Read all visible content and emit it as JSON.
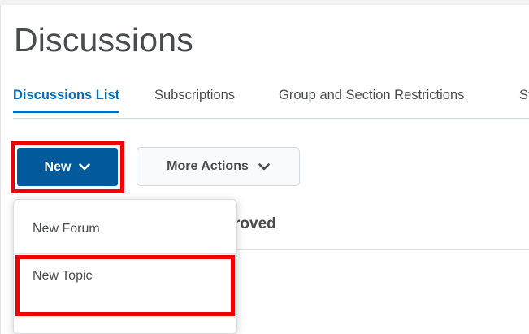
{
  "page": {
    "title": "Discussions"
  },
  "tabs": [
    {
      "label": "Discussions List",
      "active": true
    },
    {
      "label": "Subscriptions",
      "active": false
    },
    {
      "label": "Group and Section Restrictions",
      "active": false
    },
    {
      "label": "St",
      "active": false
    }
  ],
  "toolbar": {
    "new_label": "New",
    "more_actions_label": "More Actions",
    "chevron_icon": "chevron-down-icon"
  },
  "content": {
    "partial_heading": "roved"
  },
  "dropdown": {
    "items": [
      {
        "label": "New Forum"
      },
      {
        "label": "New Topic"
      }
    ]
  },
  "colors": {
    "primary": "#005a9b",
    "link_active": "#006fbf",
    "text": "#494c4e",
    "annotation": "#f00000"
  }
}
